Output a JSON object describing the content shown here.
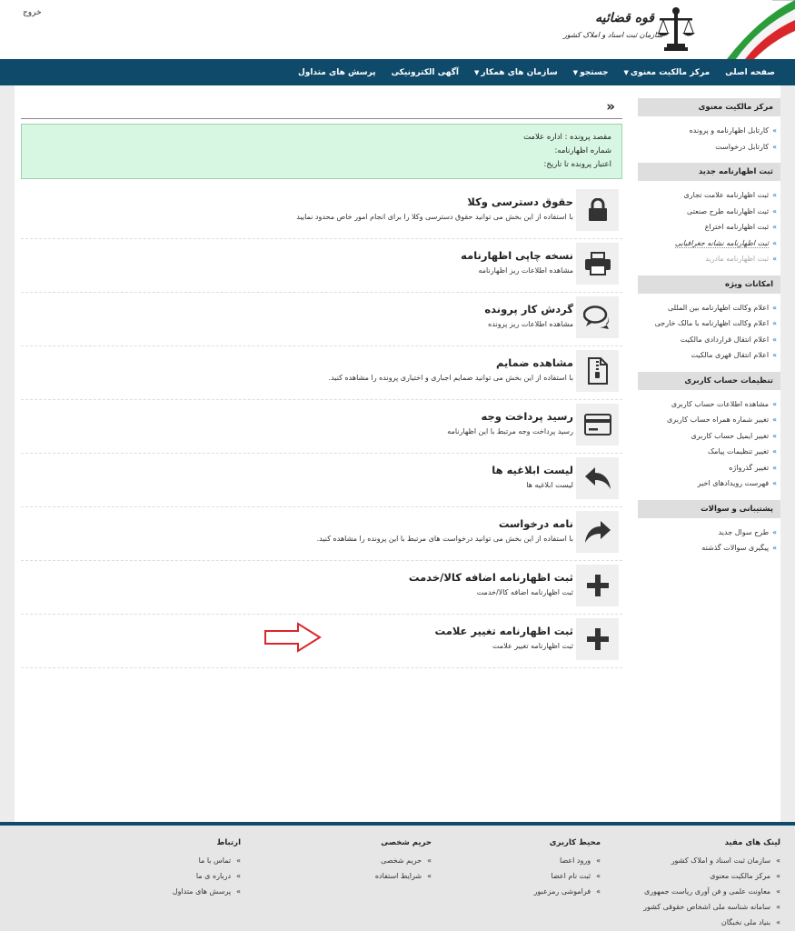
{
  "header": {
    "logout": "خروج",
    "brand_title": "قوه قضائیه",
    "brand_subtitle": "سازمان ثبت اسناد و املاک کشور"
  },
  "nav": [
    {
      "label": "صفحه اصلی",
      "dropdown": false
    },
    {
      "label": "مرکز مالکیت معنوی",
      "dropdown": true
    },
    {
      "label": "جستجو",
      "dropdown": true
    },
    {
      "label": "سازمان های همکار",
      "dropdown": true
    },
    {
      "label": "آگهی الکترونیکی",
      "dropdown": false
    },
    {
      "label": "پرسش های متداول",
      "dropdown": false
    }
  ],
  "sidebar": {
    "sections": [
      {
        "title": "مرکز مالکیت معنوی",
        "links": [
          "کارتابل اظهارنامه و پرونده",
          "کارتابل درخواست"
        ]
      },
      {
        "title": "ثبت اظهارنامه جدید",
        "links": [
          "ثبت اظهارنامه علامت تجاری",
          "ثبت اظهارنامه طرح صنعتی",
          "ثبت اظهارنامه اختراع",
          "ثبت اظهارنامه نشانه جغرافیایی",
          "ثبت اظهارنامه مادرید"
        ]
      },
      {
        "title": "امکانات ویژه",
        "links": [
          "اعلام وکالت اظهارنامه بین المللی",
          "اعلام وکالت اظهارنامه با مالک خارجی",
          "اعلام انتقال قراردادی مالکیت",
          "اعلام انتقال قهری مالکیت"
        ]
      },
      {
        "title": "تنظیمات حساب کاربری",
        "links": [
          "مشاهده اطلاعات حساب کاربری",
          "تغییر شماره همراه حساب کاربری",
          "تغییر ایمیل حساب کاربری",
          "تغییر تنظیمات پیامک",
          "تغییر گذرواژه",
          "فهرست رویدادهای اخیر"
        ]
      },
      {
        "title": "پشتیبانی و سوالات",
        "links": [
          "طرح سوال جدید",
          "پیگیری سوالات گذشته"
        ]
      }
    ]
  },
  "main": {
    "back_glyph": "»",
    "info": {
      "line1": "مقصد پرونده : اداره علامت",
      "line2": "شماره اظهارنامه:",
      "line3": "اعتبار پرونده تا تاریخ:"
    },
    "cards": [
      {
        "title": "حقوق دسترسی وکلا",
        "desc": "با استفاده از این بخش می توانید حقوق دسترسی وکلا را برای انجام امور خاص محدود نمایید",
        "icon": "lock-icon"
      },
      {
        "title": "نسخه چاپی اظهارنامه",
        "desc": "مشاهده اطلاعات ریز اظهارنامه",
        "icon": "printer-icon"
      },
      {
        "title": "گردش کار پرونده",
        "desc": "مشاهده اطلاعات ریز پرونده",
        "icon": "chat-bubbles-icon"
      },
      {
        "title": "مشاهده ضمایم",
        "desc": "با استفاده از این بخش می توانید ضمایم اجباری و اختیاری پرونده را مشاهده کنید.",
        "icon": "zip-file-icon"
      },
      {
        "title": "رسید پرداخت وجه",
        "desc": "رسید پرداخت وجه مرتبط با این اظهارنامه",
        "icon": "credit-card-icon"
      },
      {
        "title": "لیست ابلاغیه ها",
        "desc": "لیست ابلاغیه ها",
        "icon": "reply-arrow-icon"
      },
      {
        "title": "نامه درخواست",
        "desc": "با استفاده از این بخش می توانید درخواست های مرتبط با این پرونده را مشاهده کنید.",
        "icon": "forward-arrow-icon"
      },
      {
        "title": "ثبت اظهارنامه اضافه کالا/خدمت",
        "desc": "ثبت اظهارنامه اضافه کالا/خدمت",
        "icon": "plus-icon"
      },
      {
        "title": "ثبت اظهارنامه تغییر علامت",
        "desc": "ثبت اظهارنامه تغییر علامت",
        "icon": "plus-icon"
      }
    ]
  },
  "footer": {
    "columns": [
      {
        "title": "لینک های مفید",
        "links": [
          "سازمان ثبت اسناد و املاک کشور",
          "مرکز مالکیت معنوی",
          "معاونت علمی و فن آوری ریاست جمهوری",
          "سامانه شناسه ملی اشخاص حقوقی کشور",
          "بنیاد ملی نخبگان"
        ]
      },
      {
        "title": "محیط کاربری",
        "links": [
          "ورود اعضا",
          "ثبت نام اعضا",
          "فراموشی رمزعبور"
        ]
      },
      {
        "title": "حریم شخصی",
        "links": [
          "حریم شخصی",
          "شرایط استفاده"
        ]
      },
      {
        "title": "ارتباط",
        "links": [
          "تماس با ما",
          "درباره ی ما",
          "پرسش های متداول"
        ]
      }
    ]
  },
  "colors": {
    "navbar": "#0f4a6b",
    "info_bg": "#d8f7e2",
    "link_arrow": "#1a6fb0",
    "hint_arrow": "#d9262b"
  }
}
